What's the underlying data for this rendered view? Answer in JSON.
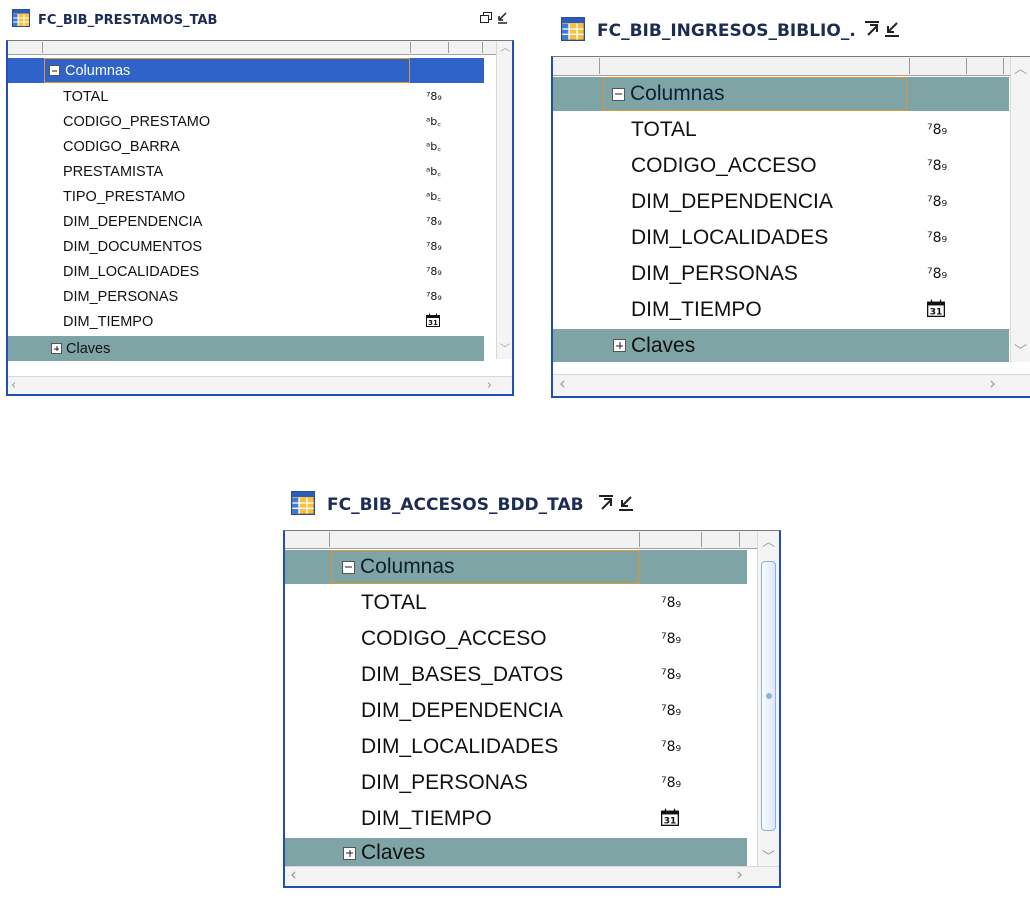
{
  "panels": [
    {
      "id": "prestamos",
      "title": "FC_BIB_PRESTAMOS_TAB",
      "group_columns": "Columnas",
      "group_keys": "Claves",
      "columns": [
        {
          "name": "TOTAL",
          "type": "numeric"
        },
        {
          "name": "CODIGO_PRESTAMO",
          "type": "text"
        },
        {
          "name": "CODIGO_BARRA",
          "type": "text"
        },
        {
          "name": "PRESTAMISTA",
          "type": "text"
        },
        {
          "name": "TIPO_PRESTAMO",
          "type": "text"
        },
        {
          "name": "DIM_DEPENDENCIA",
          "type": "numeric"
        },
        {
          "name": "DIM_DOCUMENTOS",
          "type": "numeric"
        },
        {
          "name": "DIM_LOCALIDADES",
          "type": "numeric"
        },
        {
          "name": "DIM_PERSONAS",
          "type": "numeric"
        },
        {
          "name": "DIM_TIEMPO",
          "type": "date"
        }
      ],
      "window_icons": [
        "restore-icon",
        "minimize-to-corner-icon"
      ]
    },
    {
      "id": "ingresos",
      "title": "FC_BIB_INGRESOS_BIBLIO_.",
      "group_columns": "Columnas",
      "group_keys": "Claves",
      "columns": [
        {
          "name": "TOTAL",
          "type": "numeric"
        },
        {
          "name": "CODIGO_ACCESO",
          "type": "numeric"
        },
        {
          "name": "DIM_DEPENDENCIA",
          "type": "numeric"
        },
        {
          "name": "DIM_LOCALIDADES",
          "type": "numeric"
        },
        {
          "name": "DIM_PERSONAS",
          "type": "numeric"
        },
        {
          "name": "DIM_TIEMPO",
          "type": "date"
        }
      ],
      "window_icons": [
        "expand-icon",
        "minimize-to-corner-icon"
      ]
    },
    {
      "id": "accesos",
      "title": "FC_BIB_ACCESOS_BDD_TAB",
      "group_columns": "Columnas",
      "group_keys": "Claves",
      "columns": [
        {
          "name": "TOTAL",
          "type": "numeric"
        },
        {
          "name": "CODIGO_ACCESO",
          "type": "numeric"
        },
        {
          "name": "DIM_BASES_DATOS",
          "type": "numeric"
        },
        {
          "name": "DIM_DEPENDENCIA",
          "type": "numeric"
        },
        {
          "name": "DIM_LOCALIDADES",
          "type": "numeric"
        },
        {
          "name": "DIM_PERSONAS",
          "type": "numeric"
        },
        {
          "name": "DIM_TIEMPO",
          "type": "date"
        }
      ],
      "window_icons": [
        "expand-icon",
        "minimize-to-corner-icon"
      ]
    }
  ],
  "type_glyphs": {
    "numeric": "⁷8₉",
    "text": "ᵃb꜀",
    "date": "31"
  },
  "colors": {
    "panel_border": "#1f4fb6",
    "group_row_bg": "#7fa4a6",
    "selected_row_bg": "#2f63c9",
    "focus_outline": "#e0962c",
    "title_text": "#1d2c55"
  }
}
